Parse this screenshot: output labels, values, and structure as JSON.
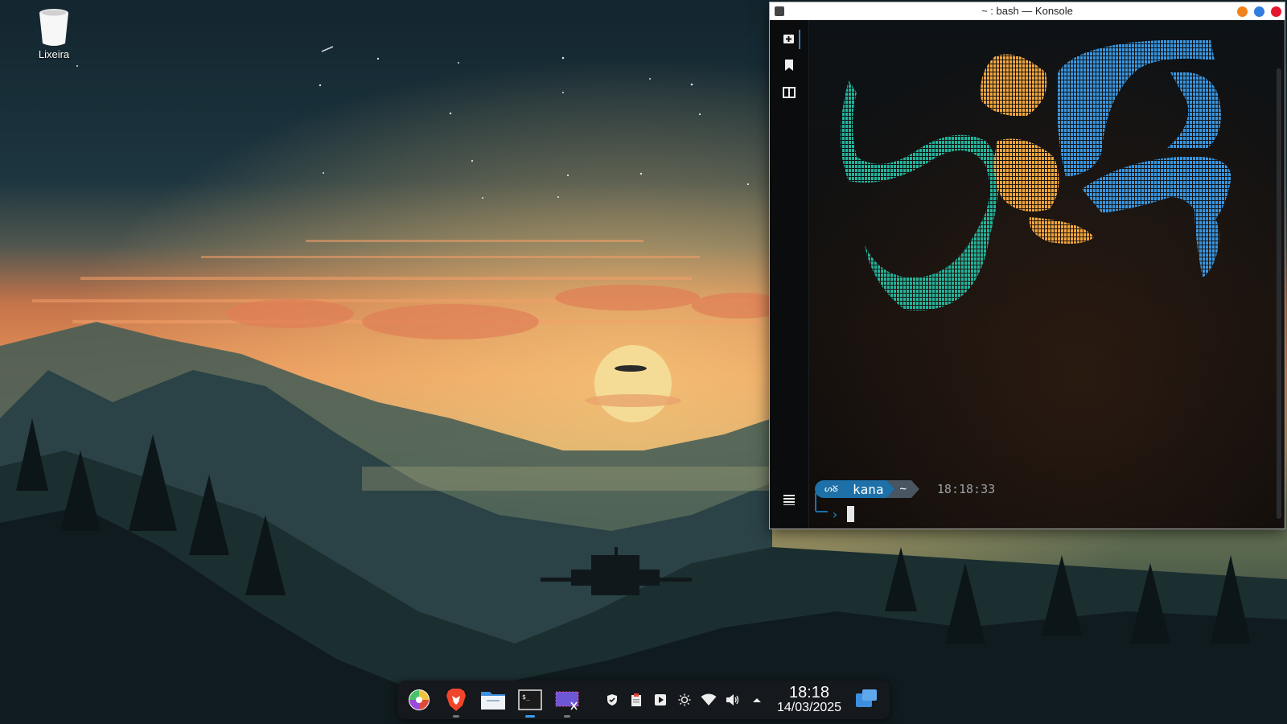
{
  "desktop": {
    "trash_label": "Lixeira"
  },
  "konsole": {
    "title": "~ : bash — Konsole",
    "prompt": {
      "icon_text": "ᔕᘜ",
      "user": "kana",
      "dir": "~",
      "time": "18:18:33",
      "chevron": "›"
    }
  },
  "taskbar": {
    "apps": [
      {
        "name": "app-launcher",
        "icon": "pinwheel-icon"
      },
      {
        "name": "brave-browser",
        "icon": "brave-lion-icon"
      },
      {
        "name": "file-manager",
        "icon": "folder-icon"
      },
      {
        "name": "konsole",
        "icon": "terminal-icon"
      },
      {
        "name": "screenshot-tool",
        "icon": "screenshot-icon"
      }
    ],
    "tray_icons": [
      "shield-icon",
      "clipboard-icon",
      "media-player-icon",
      "brightness-icon",
      "wifi-icon",
      "volume-icon",
      "tray-expand-icon"
    ],
    "clock_time": "18:18",
    "clock_date": "14/03/2025"
  },
  "colors": {
    "accent": "#3b9bea",
    "prompt_blue": "#1d70a8",
    "logo_teal": "#22b39b",
    "logo_orange": "#f3a63c",
    "logo_blue": "#3796e0"
  }
}
